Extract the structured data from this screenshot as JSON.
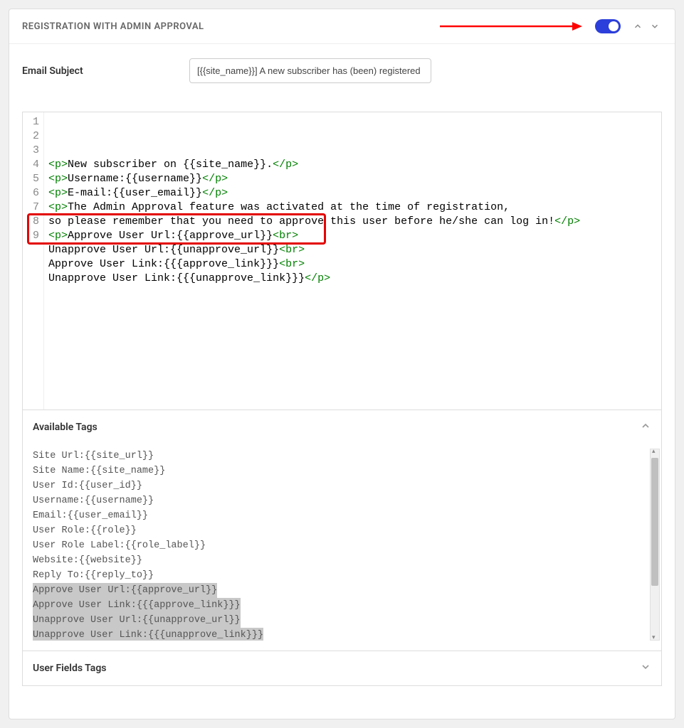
{
  "header": {
    "title": "REGISTRATION WITH ADMIN APPROVAL",
    "toggle_on": true
  },
  "subject": {
    "label": "Email Subject",
    "value": "[{{site_name}}] A new subscriber has (been) registered"
  },
  "code_lines": [
    [
      [
        "tag",
        "<p>"
      ],
      [
        "txt",
        "New subscriber on {{site_name}}."
      ],
      [
        "tag",
        "</p>"
      ]
    ],
    [
      [
        "tag",
        "<p>"
      ],
      [
        "txt",
        "Username:{{username}}"
      ],
      [
        "tag",
        "</p>"
      ]
    ],
    [
      [
        "tag",
        "<p>"
      ],
      [
        "txt",
        "E-mail:{{user_email}}"
      ],
      [
        "tag",
        "</p>"
      ]
    ],
    [
      [
        "tag",
        "<p>"
      ],
      [
        "txt",
        "The Admin Approval feature was activated at the time of registration,"
      ]
    ],
    [
      [
        "txt",
        "so please remember that you need to approve this user before he/she can log in!"
      ],
      [
        "tag",
        "</p>"
      ]
    ],
    [
      [
        "tag",
        "<p>"
      ],
      [
        "txt",
        "Approve User Url:{{approve_url}}"
      ],
      [
        "tag",
        "<br>"
      ]
    ],
    [
      [
        "txt",
        "Unapprove User Url:{{unapprove_url}}"
      ],
      [
        "tag",
        "<br>"
      ]
    ],
    [
      [
        "txt",
        "Approve User Link:{{{approve_link}}}"
      ],
      [
        "tag",
        "<br>"
      ]
    ],
    [
      [
        "txt",
        "Unapprove User Link:{{{unapprove_link}}}"
      ],
      [
        "tag",
        "</p>"
      ]
    ]
  ],
  "available_tags": {
    "title": "Available Tags",
    "items": [
      {
        "text": "Site Url:{{site_url}}",
        "selected": false
      },
      {
        "text": "Site Name:{{site_name}}",
        "selected": false
      },
      {
        "text": "User Id:{{user_id}}",
        "selected": false
      },
      {
        "text": "Username:{{username}}",
        "selected": false
      },
      {
        "text": "Email:{{user_email}}",
        "selected": false
      },
      {
        "text": "User Role:{{role}}",
        "selected": false
      },
      {
        "text": "User Role Label:{{role_label}}",
        "selected": false
      },
      {
        "text": "Website:{{website}}",
        "selected": false
      },
      {
        "text": "Reply To:{{reply_to}}",
        "selected": false
      },
      {
        "text": "Approve User Url:{{approve_url}}",
        "selected": true
      },
      {
        "text": "Approve User Link:{{{approve_link}}}",
        "selected": true
      },
      {
        "text": "Unapprove User Url:{{unapprove_url}}",
        "selected": true
      },
      {
        "text": "Unapprove User Link:{{{unapprove_link}}}",
        "selected": true
      }
    ]
  },
  "user_fields_tags": {
    "title": "User Fields Tags"
  }
}
